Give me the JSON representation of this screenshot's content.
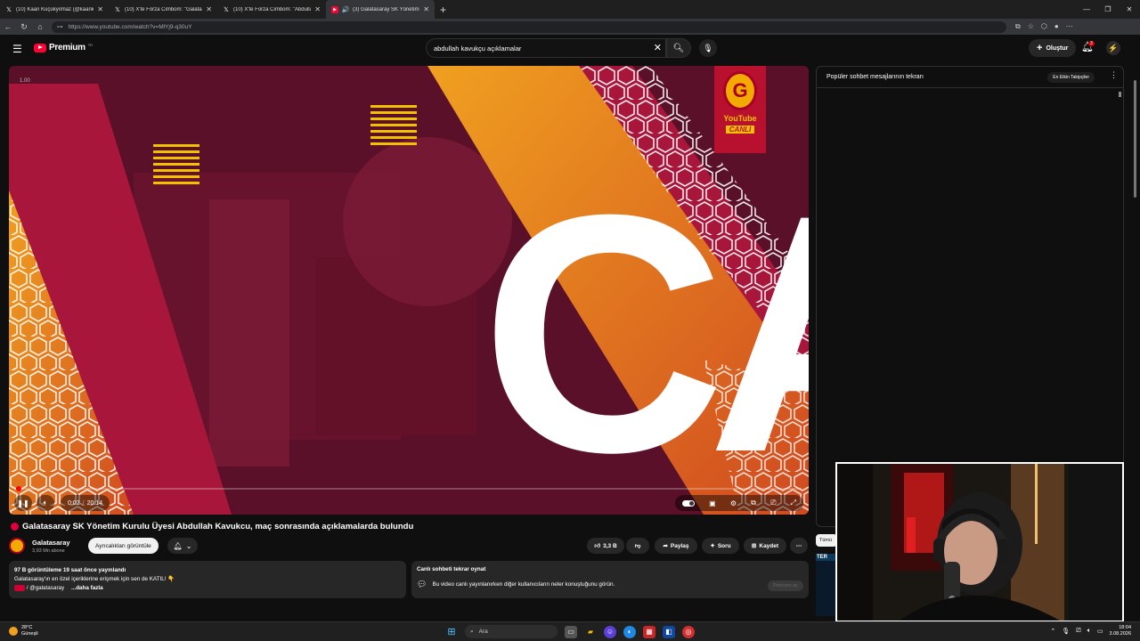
{
  "browser": {
    "tabs": [
      {
        "title": "(10) Kaan Küçükyılmaz (@kaankc...",
        "icon": "x-icon",
        "active": false
      },
      {
        "title": "(10) X'te Forza Cimbom: \"Galatasa...",
        "icon": "x-icon",
        "active": false
      },
      {
        "title": "(10) X'te Forza Cimbom: \"Abdullah...",
        "icon": "x-icon",
        "active": false
      },
      {
        "title": "(3) Galatasaray SK Yönetim...",
        "icon": "youtube-icon",
        "active": true
      }
    ],
    "new_tab": "+",
    "url": "https://www.youtube.com/watch?v=MlYj9-q30uY"
  },
  "header": {
    "logo_text": "Premium",
    "logo_country": "TR",
    "search_query": "abdullah kavukçu açıklamalar",
    "create_label": "Oluştur",
    "notif_count": "3"
  },
  "player": {
    "speed_label": "1.00",
    "current_time": "0:02",
    "duration": "20:14",
    "progress": 0.0016,
    "corner_logo_text": "YouTube",
    "corner_live_text": "CANLI",
    "big_letters": "CA"
  },
  "video": {
    "title": "Galatasaray SK Yönetim Kurulu Üyesi Abdullah Kavukcu, maç sonrasında açıklamalarda bulundu",
    "channel_name": "Galatasaray",
    "subscribers": "3,93 Mn abone",
    "members_button": "Ayrıcalıkları görüntüle",
    "likes": "3,3 B",
    "share_label": "Paylaş",
    "ask_label": "Soru",
    "save_label": "Kaydet"
  },
  "description": {
    "stats": "97 B görüntüleme  19 saat önce yayınlandı",
    "line1": "Galatasaray'ın en özel içeriklerine erişmek için sen de KATIL! 👇",
    "line2": "/ @galatasaray",
    "more": "...daha fazla"
  },
  "chat_replay": {
    "title": "Canlı sohbeti tekrar oynat",
    "text": "Bu video canlı yayınlanırken diğer kullanıcıların neler konuştuğunu görün.",
    "open_button": "Pencere aç"
  },
  "chat": {
    "header": "Popüler sohbet mesajlarının tekrarı",
    "chip": "En Etkin Takipçiler"
  },
  "sidebar_chip": "Tümü",
  "thumb_label": "TER",
  "taskbar": {
    "temperature": "28°C",
    "weather": "Güneşli",
    "search_placeholder": "Ara",
    "time": "18:04",
    "date": "3.08.2026"
  },
  "colors": {
    "bg": "#0f0f0f",
    "youtube_red": "#ff0033",
    "gs_red": "#a90027",
    "gs_yellow": "#f2a900"
  }
}
